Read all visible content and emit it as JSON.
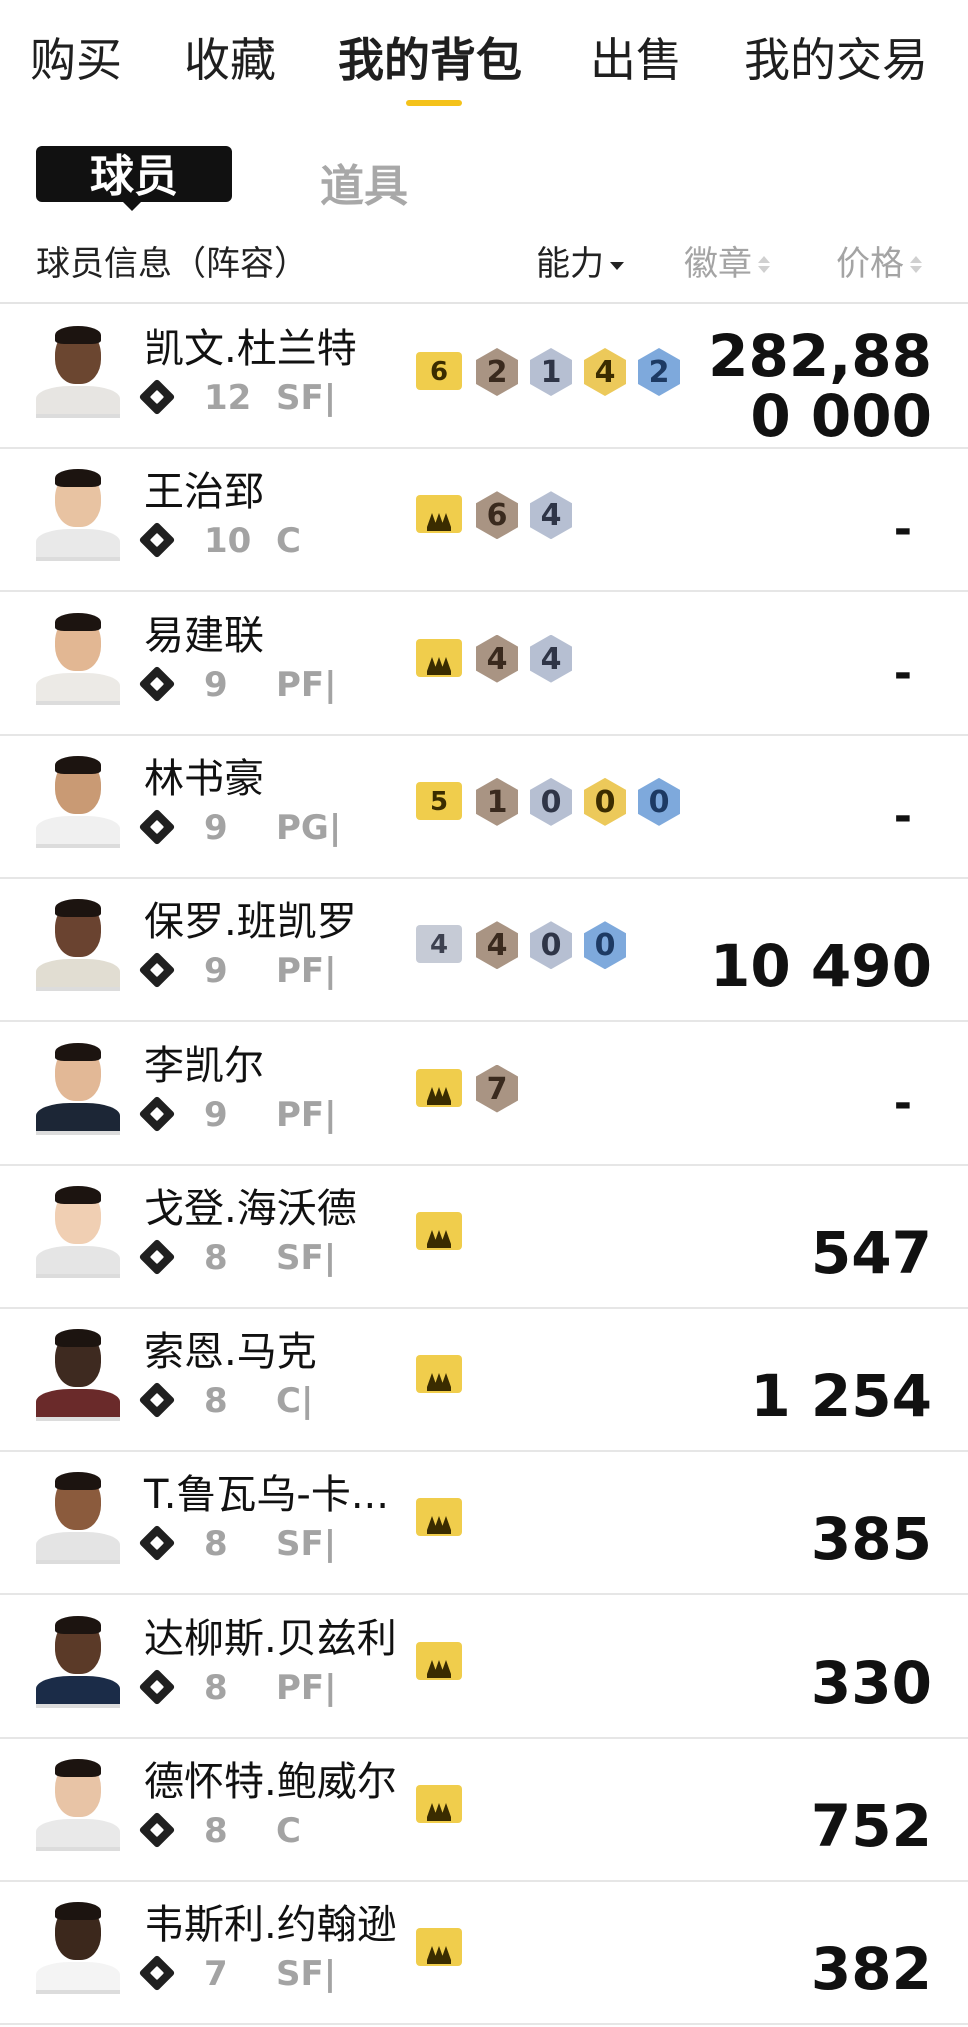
{
  "top_tabs": [
    {
      "label": "购买"
    },
    {
      "label": "收藏"
    },
    {
      "label": "我的背包"
    },
    {
      "label": "出售"
    },
    {
      "label": "我的交易"
    }
  ],
  "sub_tabs": {
    "players": "球员",
    "items": "道具"
  },
  "columns": {
    "info": "球员信息（阵容）",
    "ability": "能力",
    "badges": "徽章",
    "price": "价格"
  },
  "colors": {
    "accent": "#f4c21a",
    "badge_gold": "#f0cd4c",
    "badge_bronze": "#a99483",
    "badge_silver": "#b6bfd2",
    "badge_blue": "#7ea9dc"
  },
  "players": [
    {
      "name": "凯文.杜兰特",
      "tier_icon": "tier-13-icon",
      "rating": "12",
      "position": "SF|",
      "level": "6",
      "badges": [
        {
          "v": "2",
          "t": "bronze"
        },
        {
          "v": "1",
          "t": "silver"
        },
        {
          "v": "4",
          "t": "gold"
        },
        {
          "v": "2",
          "t": "blue"
        }
      ],
      "price": "282,880 000"
    },
    {
      "name": "王治郅",
      "tier_icon": "star-tier-icon",
      "rating": "10",
      "position": "C",
      "level": "crown",
      "badges": [
        {
          "v": "6",
          "t": "bronze"
        },
        {
          "v": "4",
          "t": "silver"
        }
      ],
      "price": "-"
    },
    {
      "name": "易建联",
      "tier_icon": "star-tier-icon",
      "rating": "9",
      "position": "PF|",
      "level": "crown",
      "badges": [
        {
          "v": "4",
          "t": "bronze"
        },
        {
          "v": "4",
          "t": "silver"
        }
      ],
      "price": "-"
    },
    {
      "name": "林书豪",
      "tier_icon": "star-tier-icon",
      "rating": "9",
      "position": "PG|",
      "level": "5",
      "badges": [
        {
          "v": "1",
          "t": "bronze"
        },
        {
          "v": "0",
          "t": "silver"
        },
        {
          "v": "0",
          "t": "gold"
        },
        {
          "v": "0",
          "t": "blue"
        }
      ],
      "price": "-"
    },
    {
      "name": "保罗.班凯罗",
      "tier_icon": "bars-tier-icon",
      "rating": "9",
      "position": "PF|",
      "level": "4",
      "level_style": "silver",
      "badges": [
        {
          "v": "4",
          "t": "bronze"
        },
        {
          "v": "0",
          "t": "silver"
        },
        {
          "v": "0",
          "t": "blue"
        }
      ],
      "price": "10 490"
    },
    {
      "name": "李凯尔",
      "tier_icon": "star-tier-icon",
      "rating": "9",
      "position": "PF|",
      "level": "crown",
      "badges": [
        {
          "v": "7",
          "t": "bronze"
        }
      ],
      "price": "-"
    },
    {
      "name": "戈登.海沃德",
      "tier_icon": "bars-tier-icon",
      "rating": "8",
      "position": "SF|",
      "level": "crown",
      "badges": [],
      "price": "547"
    },
    {
      "name": "索恩.马克",
      "tier_icon": "bars-tier-icon",
      "rating": "8",
      "position": "C|",
      "level": "crown",
      "badges": [],
      "price": "1 254"
    },
    {
      "name": "T.鲁瓦乌-卡...",
      "tier_icon": "bars-tier-icon",
      "rating": "8",
      "position": "SF|",
      "level": "crown",
      "badges": [],
      "price": "385"
    },
    {
      "name": "达柳斯.贝兹利",
      "tier_icon": "bars-tier-icon",
      "rating": "8",
      "position": "PF|",
      "level": "crown",
      "badges": [],
      "price": "330"
    },
    {
      "name": "德怀特.鲍威尔",
      "tier_icon": "bars-tier-icon",
      "rating": "8",
      "position": "C",
      "level": "crown",
      "badges": [],
      "price": "752"
    },
    {
      "name": "韦斯利.约翰逊",
      "tier_icon": "bars-tier-icon",
      "rating": "7",
      "position": "SF|",
      "level": "crown",
      "badges": [],
      "price": "382"
    }
  ]
}
